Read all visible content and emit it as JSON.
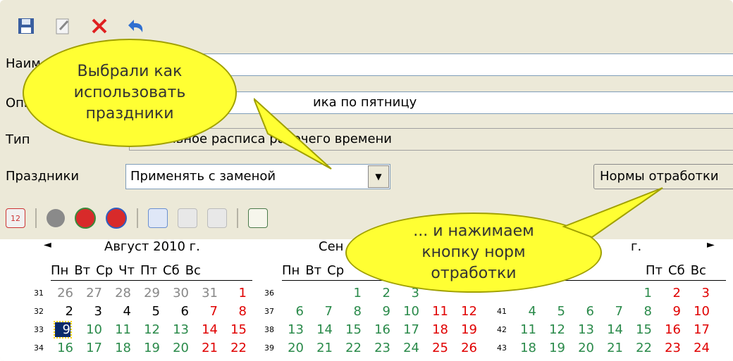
{
  "toolbar": {
    "icons": [
      "save-icon",
      "edit-icon",
      "delete-icon",
      "undo-icon"
    ]
  },
  "form": {
    "name_label": "Наим",
    "desc_label": "Опи",
    "desc_value": "ика по пятницу",
    "type_label": "Тип",
    "type_value": "Недельное расписа     рабочего времени",
    "holidays_label": "Праздники",
    "holidays_value": "Применять с заменой",
    "norms_button": "Нормы отработки"
  },
  "calendar": {
    "month1": "Август 2010 г.",
    "month2": "Сен",
    "month3": "г.",
    "weekdays": [
      "Пн",
      "Вт",
      "Ср",
      "Чт",
      "Пт",
      "Сб",
      "Вс"
    ],
    "weekdays3": [
      "Пт",
      "Сб",
      "Вс"
    ],
    "weekdays2": [
      "Пн",
      "Вт",
      "Ср"
    ],
    "m1_weeks": [
      "31",
      "32",
      "33",
      "34"
    ],
    "m1_rows": [
      [
        "26",
        "27",
        "28",
        "29",
        "30",
        "31",
        "1"
      ],
      [
        "2",
        "3",
        "4",
        "5",
        "6",
        "7",
        "8"
      ],
      [
        "9",
        "10",
        "11",
        "12",
        "13",
        "14",
        "15"
      ],
      [
        "16",
        "17",
        "18",
        "19",
        "20",
        "21",
        "22"
      ]
    ],
    "m2_weeks": [
      "36",
      "37",
      "38",
      "39"
    ],
    "m2_rows": [
      [
        "",
        "",
        "1",
        "2",
        "3",
        "",
        ""
      ],
      [
        "6",
        "7",
        "8",
        "9",
        "10",
        "11",
        "12"
      ],
      [
        "13",
        "14",
        "15",
        "16",
        "17",
        "18",
        "19"
      ],
      [
        "20",
        "21",
        "22",
        "23",
        "24",
        "25",
        "26"
      ]
    ],
    "m3_weeks": [
      "",
      "41",
      "42",
      "43"
    ],
    "m3_rows": [
      [
        "",
        "",
        "",
        "",
        "1",
        "2",
        "3"
      ],
      [
        "4",
        "5",
        "6",
        "7",
        "8",
        "9",
        "10"
      ],
      [
        "11",
        "12",
        "13",
        "14",
        "15",
        "16",
        "17"
      ],
      [
        "18",
        "19",
        "20",
        "21",
        "22",
        "23",
        "24"
      ]
    ]
  },
  "callouts": {
    "c1": "Выбрали как использовать праздники",
    "c2": "... и нажимаем кнопку норм отработки"
  },
  "colors": {
    "weekend": "#e00000",
    "workday": "#2a8a4a",
    "accent": "#ffff33"
  }
}
